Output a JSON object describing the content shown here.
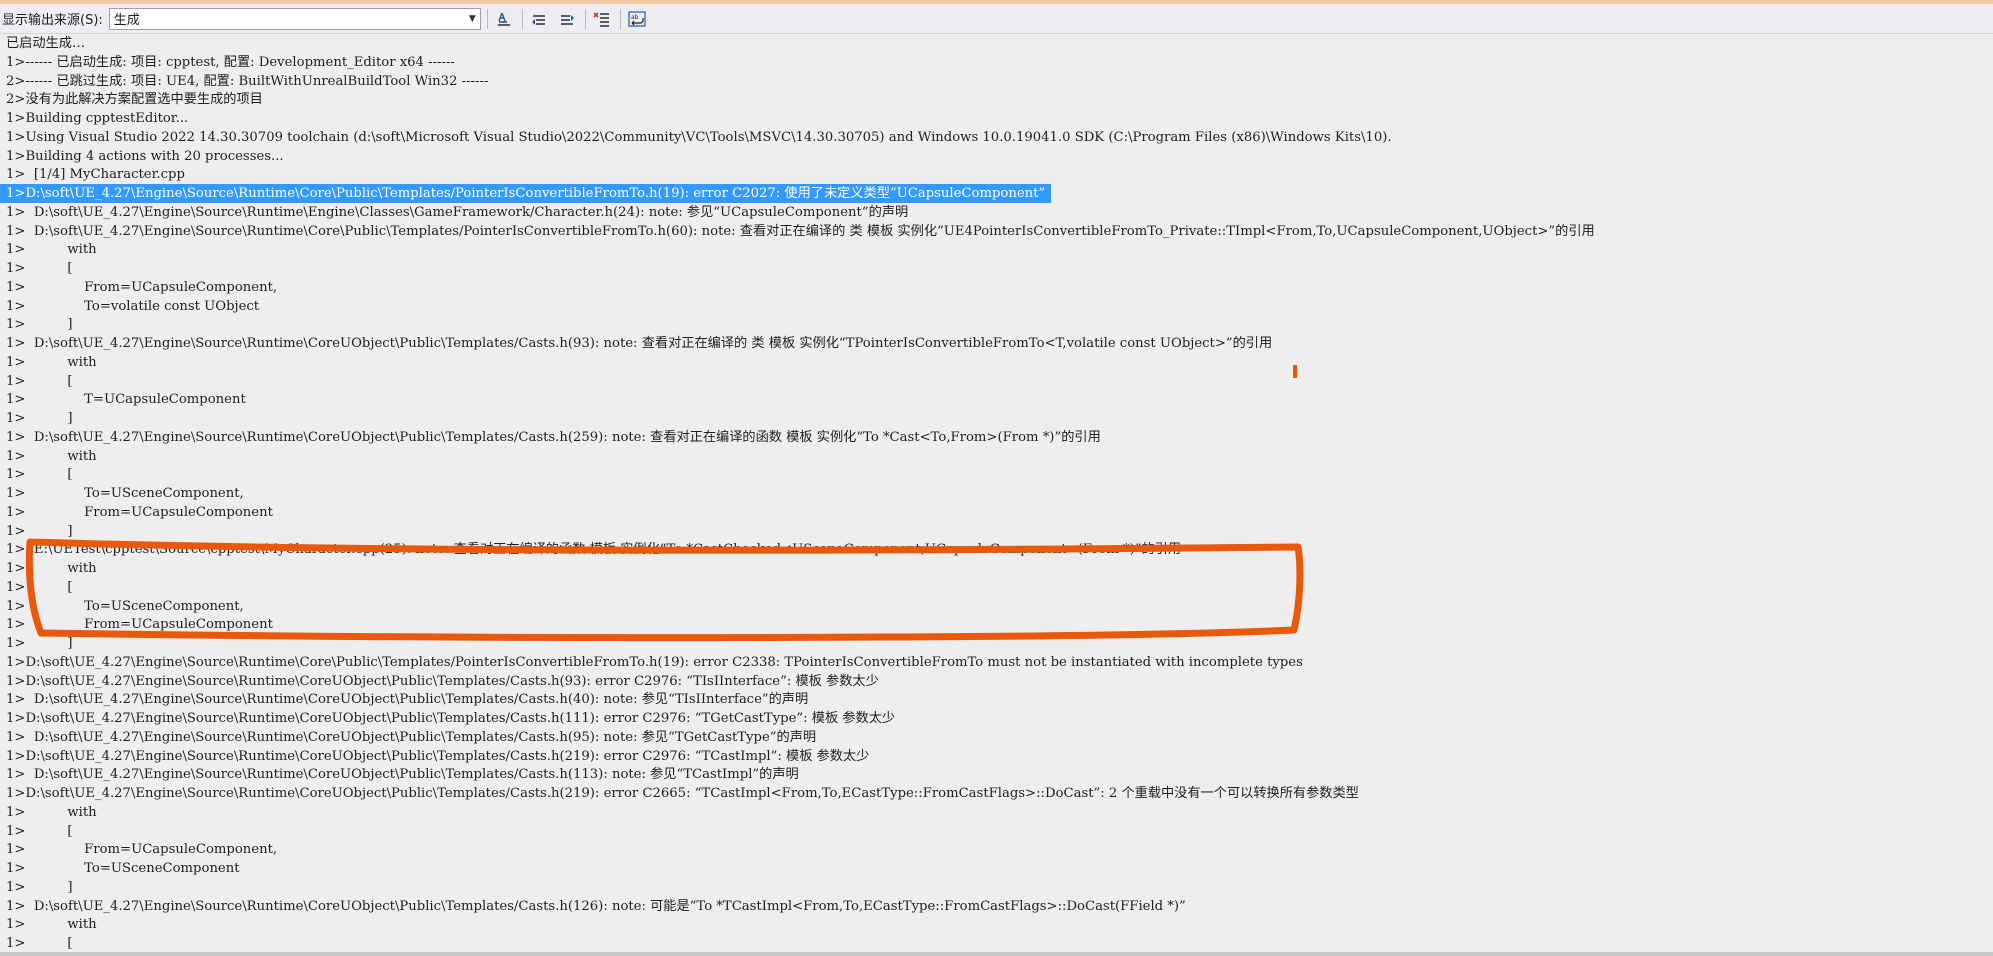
{
  "toolbar": {
    "source_label": "显示输出来源(S):",
    "source_value": "生成"
  },
  "icons": [
    "find-message-icon",
    "prev-message-icon",
    "next-message-icon",
    "clear-all-icon",
    "word-wrap-icon"
  ],
  "colors": {
    "selection": "#3399ff",
    "annotation": "#e8590c"
  },
  "output_lines": [
    "已启动生成…",
    "1>------ 已启动生成: 项目: cpptest, 配置: Development_Editor x64 ------",
    "2>------ 已跳过生成: 项目: UE4, 配置: BuiltWithUnrealBuildTool Win32 ------",
    "2>没有为此解决方案配置选中要生成的项目",
    "1>Building cpptestEditor...",
    "1>Using Visual Studio 2022 14.30.30709 toolchain (d:\\soft\\Microsoft Visual Studio\\2022\\Community\\VC\\Tools\\MSVC\\14.30.30705) and Windows 10.0.19041.0 SDK (C:\\Program Files (x86)\\Windows Kits\\10).",
    "1>Building 4 actions with 20 processes...",
    "1>  [1/4] MyCharacter.cpp",
    "1>D:\\soft\\UE_4.27\\Engine\\Source\\Runtime\\Core\\Public\\Templates/PointerIsConvertibleFromTo.h(19): error C2027: 使用了未定义类型“UCapsuleComponent”",
    "1>  D:\\soft\\UE_4.27\\Engine\\Source\\Runtime\\Engine\\Classes\\GameFramework/Character.h(24): note: 参见“UCapsuleComponent”的声明",
    "1>  D:\\soft\\UE_4.27\\Engine\\Source\\Runtime\\Core\\Public\\Templates/PointerIsConvertibleFromTo.h(60): note: 查看对正在编译的 类 模板 实例化“UE4PointerIsConvertibleFromTo_Private::TImpl<From,To,UCapsuleComponent,UObject>”的引用",
    "1>          with",
    "1>          [",
    "1>              From=UCapsuleComponent,",
    "1>              To=volatile const UObject",
    "1>          ]",
    "1>  D:\\soft\\UE_4.27\\Engine\\Source\\Runtime\\CoreUObject\\Public\\Templates/Casts.h(93): note: 查看对正在编译的 类 模板 实例化“TPointerIsConvertibleFromTo<T,volatile const UObject>”的引用",
    "1>          with",
    "1>          [",
    "1>              T=UCapsuleComponent",
    "1>          ]",
    "1>  D:\\soft\\UE_4.27\\Engine\\Source\\Runtime\\CoreUObject\\Public\\Templates/Casts.h(259): note: 查看对正在编译的函数 模板 实例化“To *Cast<To,From>(From *)”的引用",
    "1>          with",
    "1>          [",
    "1>              To=USceneComponent,",
    "1>              From=UCapsuleComponent",
    "1>          ]",
    "1>  E:\\UETest\\cpptest\\Source\\cpptest\\MyCharacter.cpp(25): note: 查看对正在编译的函数 模板 实例化“To *CastChecked<USceneComponent,UCapsuleComponent>(From *)”的引用",
    "1>          with",
    "1>          [",
    "1>              To=USceneComponent,",
    "1>              From=UCapsuleComponent",
    "1>          ]",
    "1>D:\\soft\\UE_4.27\\Engine\\Source\\Runtime\\Core\\Public\\Templates/PointerIsConvertibleFromTo.h(19): error C2338: TPointerIsConvertibleFromTo must not be instantiated with incomplete types",
    "1>D:\\soft\\UE_4.27\\Engine\\Source\\Runtime\\CoreUObject\\Public\\Templates/Casts.h(93): error C2976: “TIsIInterface”: 模板 参数太少",
    "1>  D:\\soft\\UE_4.27\\Engine\\Source\\Runtime\\CoreUObject\\Public\\Templates/Casts.h(40): note: 参见“TIsIInterface”的声明",
    "1>D:\\soft\\UE_4.27\\Engine\\Source\\Runtime\\CoreUObject\\Public\\Templates/Casts.h(111): error C2976: “TGetCastType”: 模板 参数太少",
    "1>  D:\\soft\\UE_4.27\\Engine\\Source\\Runtime\\CoreUObject\\Public\\Templates/Casts.h(95): note: 参见“TGetCastType”的声明",
    "1>D:\\soft\\UE_4.27\\Engine\\Source\\Runtime\\CoreUObject\\Public\\Templates/Casts.h(219): error C2976: “TCastImpl”: 模板 参数太少",
    "1>  D:\\soft\\UE_4.27\\Engine\\Source\\Runtime\\CoreUObject\\Public\\Templates/Casts.h(113): note: 参见“TCastImpl”的声明",
    "1>D:\\soft\\UE_4.27\\Engine\\Source\\Runtime\\CoreUObject\\Public\\Templates/Casts.h(219): error C2665: “TCastImpl<From,To,ECastType::FromCastFlags>::DoCast”: 2 个重载中没有一个可以转换所有参数类型",
    "1>          with",
    "1>          [",
    "1>              From=UCapsuleComponent,",
    "1>              To=USceneComponent",
    "1>          ]",
    "1>  D:\\soft\\UE_4.27\\Engine\\Source\\Runtime\\CoreUObject\\Public\\Templates/Casts.h(126): note: 可能是“To *TCastImpl<From,To,ECastType::FromCastFlags>::DoCast(FField *)”",
    "1>          with",
    "1>          ["
  ],
  "selected_line_index": 8
}
